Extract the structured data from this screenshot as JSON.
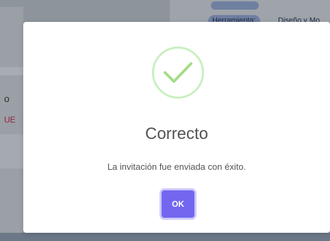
{
  "background": {
    "left_text_1": "o",
    "left_text_2": "UE",
    "chip_label": "Herramienta:",
    "tool_value": "Diseño y Mo"
  },
  "modal": {
    "icon": "checkmark-circle-icon",
    "title": "Correcto",
    "message": "La invitación fue enviada con éxito.",
    "ok_label": "OK"
  },
  "colors": {
    "success_green": "#a5dc86",
    "button_purple": "#7367f0",
    "overlay": "#8d949b"
  }
}
